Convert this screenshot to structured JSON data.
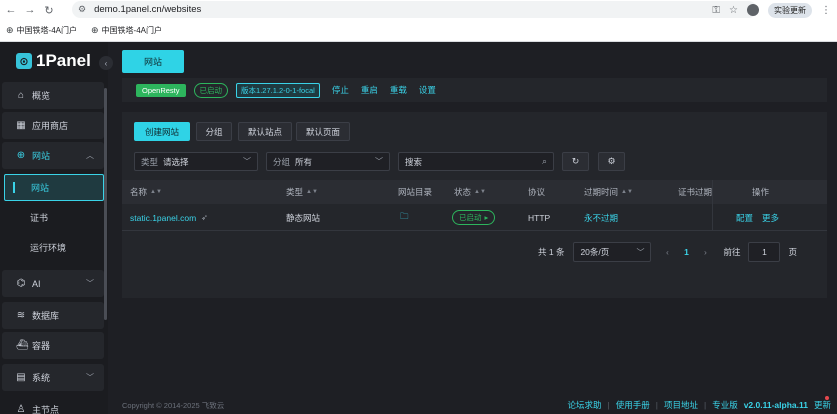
{
  "browser": {
    "url": "demo.1panel.cn/websites",
    "update_label": "实验更新",
    "bookmarks": [
      "中国铁塔-4A门户",
      "中国铁塔-4A门户"
    ]
  },
  "app": {
    "logo": "1Panel",
    "logo_mark": "⊙"
  },
  "sidebar": {
    "items": [
      {
        "label": "概览",
        "icon": "home-icon"
      },
      {
        "label": "应用商店",
        "icon": "grid-icon"
      },
      {
        "label": "网站",
        "icon": "globe-icon"
      },
      {
        "label": "AI",
        "icon": "robot-icon"
      },
      {
        "label": "数据库",
        "icon": "database-icon"
      },
      {
        "label": "容器",
        "icon": "container-icon"
      },
      {
        "label": "系统",
        "icon": "system-icon"
      },
      {
        "label": "主节点",
        "icon": "user-icon"
      }
    ],
    "sub_items": [
      "网站",
      "证书",
      "运行环境"
    ]
  },
  "page_tab": "网站",
  "status": {
    "openresty": "OpenResty",
    "running": "已启动",
    "version": "版本1.27.1.2-0-1-focal",
    "stop": "停止",
    "restart": "重启",
    "reload": "重载",
    "settings": "设置"
  },
  "toolbar": {
    "create": "创建网站",
    "group": "分组",
    "default_site": "默认站点",
    "default_page": "默认页面",
    "type_label": "类型",
    "type_value": "请选择",
    "group_label": "分组",
    "group_value": "所有",
    "search_placeholder": "搜索"
  },
  "table": {
    "headers": [
      "名称",
      "类型",
      "网站目录",
      "状态",
      "协议",
      "过期时间",
      "证书过期",
      "操作"
    ],
    "rows": [
      {
        "name": "static.1panel.com",
        "type": "静态网站",
        "status": "已启动",
        "protocol": "HTTP",
        "expire": "永不过期",
        "actions": [
          "配置",
          "更多"
        ]
      }
    ]
  },
  "pagination": {
    "total": "共 1 条",
    "page_size": "20条/页",
    "current": "1",
    "goto_label": "前往",
    "goto_value": "1",
    "page_suffix": "页"
  },
  "footer": {
    "copyright": "Copyright © 2014-2025 飞致云",
    "links": [
      "论坛求助",
      "使用手册",
      "项目地址",
      "专业版"
    ],
    "version": "v2.0.11-alpha.11",
    "update": "更新"
  }
}
